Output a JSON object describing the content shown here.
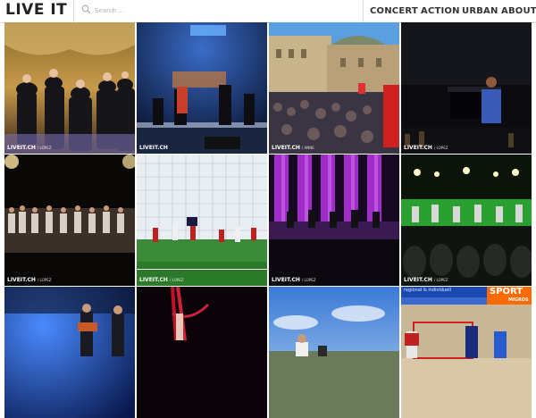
{
  "header": {
    "logo": "LIVE IT",
    "search_placeholder": "Search ...",
    "nav": [
      "CONCERT",
      "ACTION",
      "URBAN",
      "ABOUT"
    ]
  },
  "icons": {
    "search": "search-icon"
  },
  "gallery": {
    "tiles": [
      {
        "label": "Music group in suits on stage",
        "credit": "LIVEIT.CH",
        "credit_sub": "/ LOPEZ"
      },
      {
        "label": "Band performing on blue-lit stage",
        "credit": "LIVEIT.CH",
        "credit_sub": ""
      },
      {
        "label": "Crowd gathered in front of parliament building",
        "credit": "LIVEIT.CH",
        "credit_sub": "/ ANNE"
      },
      {
        "label": "Pianist performing on dark stage",
        "credit": "LIVEIT.CH",
        "credit_sub": "/ LOPEZ"
      },
      {
        "label": "Choir on stage with audience",
        "credit": "LIVEIT.CH",
        "credit_sub": "/ LOPEZ"
      },
      {
        "label": "Football goalkeeper and players in front of goal",
        "credit": "LIVEIT.CH",
        "credit_sub": "/ LOPEZ"
      },
      {
        "label": "Ensemble on purple-lit stage",
        "credit": "LIVEIT.CH",
        "credit_sub": "/ LOPEZ"
      },
      {
        "label": "Orchestra on green-lit stage with audience",
        "credit": "LIVEIT.CH",
        "credit_sub": "/ LOPEZ"
      },
      {
        "label": "Guitarists performing under blue lights",
        "credit": "",
        "credit_sub": ""
      },
      {
        "label": "Aerial acrobat with red ribbons",
        "credit": "",
        "credit_sub": ""
      },
      {
        "label": "Outdoor event under blue sky",
        "credit": "",
        "credit_sub": ""
      },
      {
        "label": "Indoor handball match",
        "credit": "",
        "credit_sub": ""
      }
    ]
  },
  "banner": {
    "line1": "regional & individuell",
    "brand": "SPORT",
    "brand2": "MIGROS"
  }
}
